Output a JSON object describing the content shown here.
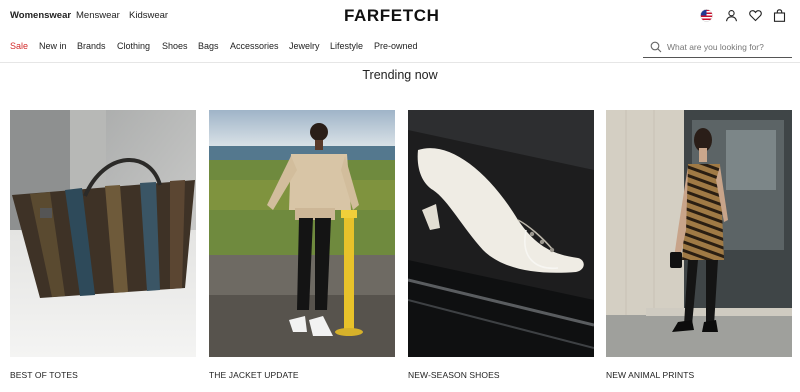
{
  "header": {
    "gender_tabs": [
      {
        "label": "Womenswear",
        "active": true
      },
      {
        "label": "Menswear",
        "active": false
      },
      {
        "label": "Kidswear",
        "active": false
      }
    ],
    "logo": "FARFETCH",
    "icons": [
      "us-flag-icon",
      "account-icon",
      "wishlist-heart-icon",
      "shopping-bag-icon"
    ]
  },
  "nav": {
    "items": [
      "Sale",
      "New in",
      "Brands",
      "Clothing",
      "Shoes",
      "Bags",
      "Accessories",
      "Jewelry",
      "Lifestyle",
      "Pre-owned"
    ],
    "sale_color": "#d22b2b"
  },
  "search": {
    "placeholder": "What are you looking for?",
    "value": ""
  },
  "main": {
    "section_title": "Trending now",
    "cards": [
      {
        "label": "BEST OF TOTES",
        "image": "tote-bag-photo"
      },
      {
        "label": "THE JACKET UPDATE",
        "image": "jacket-model-photo"
      },
      {
        "label": "NEW-SEASON SHOES",
        "image": "white-heel-shoe-photo"
      },
      {
        "label": "NEW ANIMAL PRINTS",
        "image": "animal-print-dress-photo"
      }
    ]
  }
}
